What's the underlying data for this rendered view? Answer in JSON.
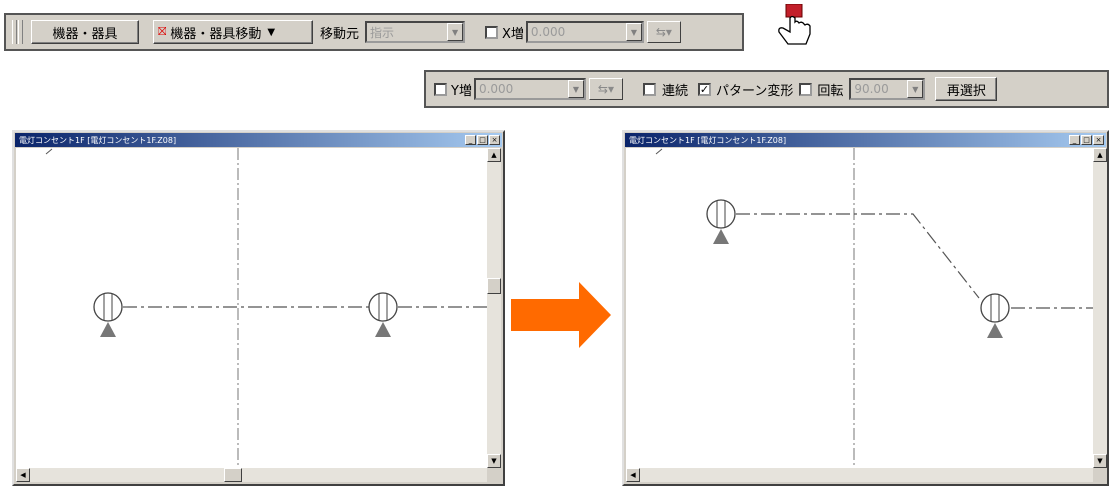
{
  "toolbar1": {
    "category_button": "機器・器具",
    "command_dropdown": "機器・器具移動",
    "source_label": "移動元",
    "source_value": "指示",
    "x_check_label": "X増",
    "x_value": "0.000"
  },
  "toolbar2": {
    "y_check_label": "Y増",
    "y_value": "0.000",
    "continuous_label": "連続",
    "continuous_checked": false,
    "pattern_label": "パターン変形",
    "pattern_checked": true,
    "rotate_label": "回転",
    "rotate_value": "90.00",
    "reselect_button": "再選択"
  },
  "window_before": {
    "title": "電灯コンセント1F [電灯コンセント1F.Z08]"
  },
  "window_after": {
    "title": "電灯コンセント1F [電灯コンセント1F.Z08]"
  },
  "colors": {
    "arrow": "#ff6a00",
    "titlebar_start": "#0a246a",
    "titlebar_end": "#a6caf0",
    "face": "#d4d0c8"
  },
  "icons": [
    "pointer-hand-icon",
    "move-device-icon",
    "flip-arrows-icon",
    "dropdown-icon",
    "arrow-right-icon",
    "outlet-symbol-icon"
  ]
}
